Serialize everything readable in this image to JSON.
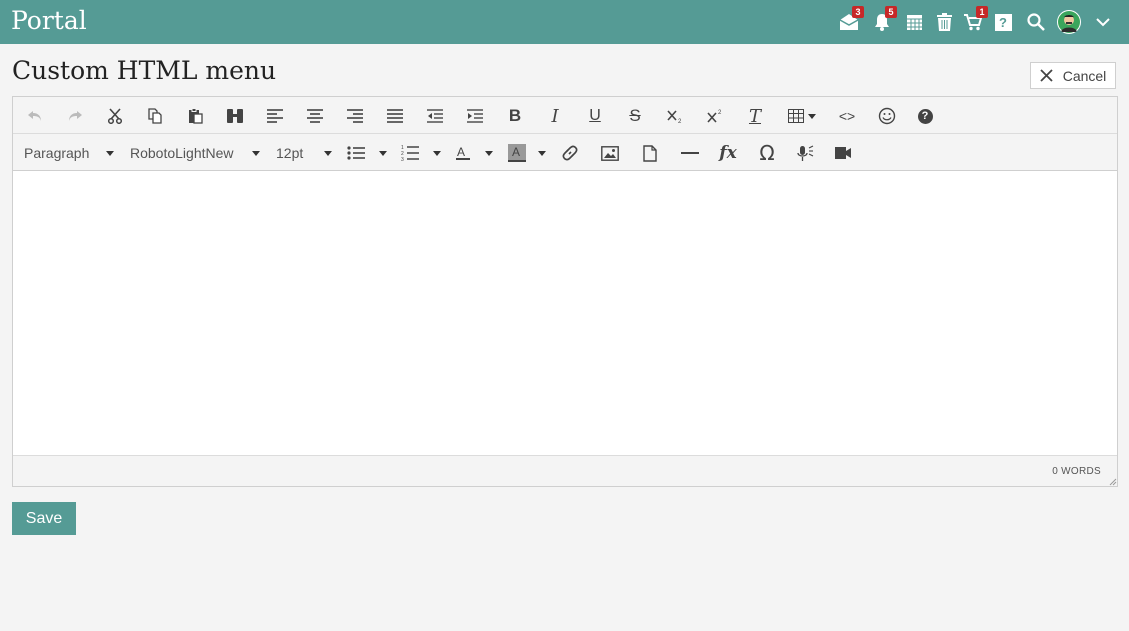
{
  "app": {
    "brand": "Portal"
  },
  "header": {
    "icons": [
      {
        "name": "messages-icon",
        "badge": "3"
      },
      {
        "name": "notifications-icon",
        "badge": "5"
      },
      {
        "name": "calendar-icon",
        "badge": ""
      },
      {
        "name": "trash-icon",
        "badge": ""
      },
      {
        "name": "cart-icon",
        "badge": "1"
      },
      {
        "name": "help-icon",
        "badge": ""
      },
      {
        "name": "search-icon",
        "badge": ""
      }
    ],
    "badges": {
      "messages": "3",
      "notifications": "5",
      "cart": "1"
    },
    "help_glyph": "?"
  },
  "page": {
    "title": "Custom HTML menu",
    "cancel_label": "Cancel"
  },
  "editor": {
    "format_select": "Paragraph",
    "font_select": "RobotoLightNew",
    "size_select": "12pt",
    "word_count": "0 WORDS",
    "glyphs": {
      "bold": "B",
      "italic": "I",
      "underline": "U",
      "strike": "S",
      "clear": "T",
      "fx": "fx",
      "omega": "Ω",
      "code": "<>",
      "help": "?"
    }
  },
  "actions": {
    "save_label": "Save"
  },
  "colors": {
    "accent": "#559b95",
    "badge": "#c62828"
  }
}
